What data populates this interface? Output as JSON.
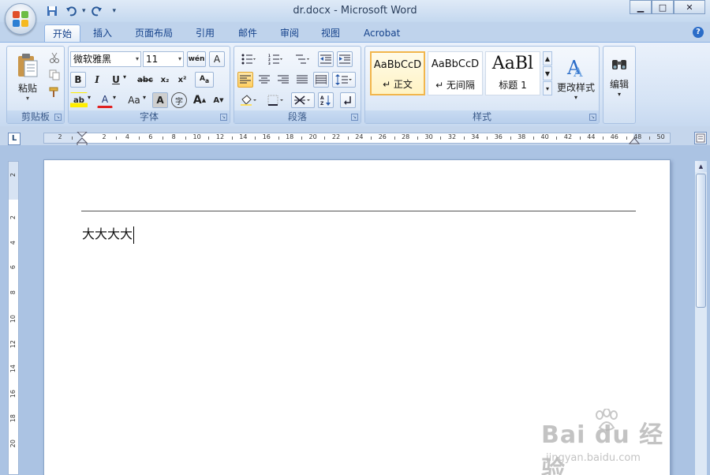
{
  "window": {
    "title": "dr.docx - Microsoft Word",
    "controls": {
      "minimize": "▁",
      "maximize": "□",
      "close": "✕"
    }
  },
  "qat": {
    "save_icon": "save-icon",
    "undo_icon": "undo-icon",
    "redo_icon": "redo-icon",
    "more": "▾"
  },
  "tabs": [
    {
      "label": "开始",
      "active": true
    },
    {
      "label": "插入"
    },
    {
      "label": "页面布局"
    },
    {
      "label": "引用"
    },
    {
      "label": "邮件"
    },
    {
      "label": "审阅"
    },
    {
      "label": "视图"
    },
    {
      "label": "Acrobat"
    }
  ],
  "ribbon": {
    "clipboard": {
      "label": "剪贴板",
      "paste": "粘贴"
    },
    "font": {
      "label": "字体",
      "font_name": "微软雅黑",
      "font_size": "11",
      "bold": "B",
      "italic": "I",
      "underline": "U",
      "strike": "abc",
      "sub": "x₂",
      "sup": "x²",
      "highlight": "ab",
      "color": "A",
      "case": "Aa",
      "char_shade": "A",
      "enclose": "字",
      "grow": "A",
      "shrink": "A",
      "wen": "wén"
    },
    "paragraph": {
      "label": "段落"
    },
    "styles": {
      "label": "样式",
      "items": [
        {
          "sample": "AaBbCcD",
          "name": "↵ 正文",
          "selected": true
        },
        {
          "sample": "AaBbCcD",
          "name": "↵ 无间隔"
        },
        {
          "sample": "AaBl",
          "name": "标题 1"
        }
      ],
      "change_styles": "更改样式"
    },
    "editing": {
      "label": "编辑"
    }
  },
  "ruler": {
    "h_numbers": [
      "2",
      "2",
      "4",
      "6",
      "8",
      "10",
      "12",
      "14",
      "16",
      "18",
      "20",
      "22",
      "24",
      "26",
      "28",
      "30",
      "32",
      "34",
      "36",
      "38",
      "40",
      "42",
      "44",
      "46",
      "48",
      "50"
    ],
    "v_numbers": [
      "2",
      "2",
      "4",
      "6",
      "8",
      "10",
      "12",
      "14",
      "16",
      "18",
      "20"
    ]
  },
  "document": {
    "text": "大大大大"
  },
  "watermark": {
    "main": "Bai du 经验",
    "sub": "jingyan.baidu.com"
  }
}
